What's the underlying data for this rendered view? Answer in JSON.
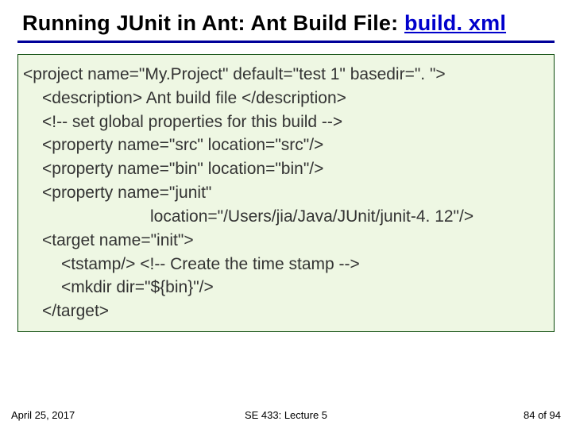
{
  "title": {
    "prefix": "Running JUnit in Ant: Ant Build File: ",
    "link_text": "build. xml"
  },
  "code": {
    "l1": "<project name=\"My.Project\" default=\"test 1\" basedir=\". \">",
    "l2": "<description> Ant build file </description>",
    "l3": "<!-- set global properties for this build -->",
    "l4": "<property name=\"src\" location=\"src\"/>",
    "l5": "<property name=\"bin\" location=\"bin\"/>",
    "l6": "<property name=\"junit\"",
    "l7": "location=\"/Users/jia/Java/JUnit/junit-4. 12\"/>",
    "l8": "<target name=\"init\">",
    "l9": "<tstamp/> <!-- Create the time stamp -->",
    "l10": "<mkdir dir=\"${bin}\"/>",
    "l11": "</target>"
  },
  "footer": {
    "date": "April 25, 2017",
    "center": "SE 433: Lecture 5",
    "page": "84 of 94"
  }
}
